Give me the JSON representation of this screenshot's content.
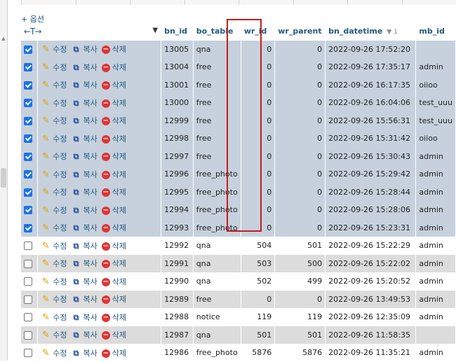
{
  "options_link": "+ 옵션",
  "columns": {
    "bn_id": "bn_id",
    "bo_table": "bo_table",
    "wr_id": "wr_id",
    "wr_parent": "wr_parent",
    "bn_datetime": "bn_datetime",
    "sort_marker": "▼ 1",
    "mb_id": "mb_id"
  },
  "actions": {
    "edit": "수정",
    "copy": "복사",
    "delete": "삭제"
  },
  "colors": {
    "selected_row": "#c6d1dd",
    "odd_row": "#dcdcdc",
    "highlight_border": "#c81c1c",
    "link": "#235a81"
  },
  "rows": [
    {
      "checked": true,
      "bn_id": "13005",
      "bo_table": "qna",
      "wr_id": "0",
      "wr_parent": "0",
      "bn_datetime": "2022-09-26 17:52:20",
      "mb_id": ""
    },
    {
      "checked": true,
      "bn_id": "13004",
      "bo_table": "free",
      "wr_id": "0",
      "wr_parent": "0",
      "bn_datetime": "2022-09-26 17:35:17",
      "mb_id": "admin"
    },
    {
      "checked": true,
      "bn_id": "13001",
      "bo_table": "free",
      "wr_id": "0",
      "wr_parent": "0",
      "bn_datetime": "2022-09-26 16:17:35",
      "mb_id": "oiioo"
    },
    {
      "checked": true,
      "bn_id": "13000",
      "bo_table": "free",
      "wr_id": "0",
      "wr_parent": "0",
      "bn_datetime": "2022-09-26 16:04:06",
      "mb_id": "test_uuu"
    },
    {
      "checked": true,
      "bn_id": "12999",
      "bo_table": "free",
      "wr_id": "0",
      "wr_parent": "0",
      "bn_datetime": "2022-09-26 15:56:31",
      "mb_id": "test_uuu"
    },
    {
      "checked": true,
      "bn_id": "12998",
      "bo_table": "free",
      "wr_id": "0",
      "wr_parent": "0",
      "bn_datetime": "2022-09-26 15:31:42",
      "mb_id": "oiioo"
    },
    {
      "checked": true,
      "bn_id": "12997",
      "bo_table": "free",
      "wr_id": "0",
      "wr_parent": "0",
      "bn_datetime": "2022-09-26 15:30:43",
      "mb_id": "admin"
    },
    {
      "checked": true,
      "bn_id": "12996",
      "bo_table": "free_photo",
      "wr_id": "0",
      "wr_parent": "0",
      "bn_datetime": "2022-09-26 15:29:42",
      "mb_id": "admin"
    },
    {
      "checked": true,
      "bn_id": "12995",
      "bo_table": "free_photo",
      "wr_id": "0",
      "wr_parent": "0",
      "bn_datetime": "2022-09-26 15:28:44",
      "mb_id": "admin"
    },
    {
      "checked": true,
      "bn_id": "12994",
      "bo_table": "free_photo",
      "wr_id": "0",
      "wr_parent": "0",
      "bn_datetime": "2022-09-26 15:28:06",
      "mb_id": "admin"
    },
    {
      "checked": true,
      "bn_id": "12993",
      "bo_table": "free_photo",
      "wr_id": "0",
      "wr_parent": "0",
      "bn_datetime": "2022-09-26 15:23:31",
      "mb_id": "admin"
    },
    {
      "checked": false,
      "bn_id": "12992",
      "bo_table": "qna",
      "wr_id": "504",
      "wr_parent": "501",
      "bn_datetime": "2022-09-26 15:22:29",
      "mb_id": "admin"
    },
    {
      "checked": false,
      "bn_id": "12991",
      "bo_table": "qna",
      "wr_id": "503",
      "wr_parent": "500",
      "bn_datetime": "2022-09-26 15:22:02",
      "mb_id": "admin"
    },
    {
      "checked": false,
      "bn_id": "12990",
      "bo_table": "qna",
      "wr_id": "502",
      "wr_parent": "499",
      "bn_datetime": "2022-09-26 15:20:52",
      "mb_id": "admin"
    },
    {
      "checked": false,
      "bn_id": "12989",
      "bo_table": "free",
      "wr_id": "0",
      "wr_parent": "0",
      "bn_datetime": "2022-09-26 13:49:53",
      "mb_id": "admin"
    },
    {
      "checked": false,
      "bn_id": "12988",
      "bo_table": "notice",
      "wr_id": "119",
      "wr_parent": "119",
      "bn_datetime": "2022-09-26 12:35:09",
      "mb_id": "admin"
    },
    {
      "checked": false,
      "bn_id": "12987",
      "bo_table": "qna",
      "wr_id": "501",
      "wr_parent": "501",
      "bn_datetime": "2022-09-26 11:58:35",
      "mb_id": ""
    },
    {
      "checked": false,
      "bn_id": "12986",
      "bo_table": "free_photo",
      "wr_id": "5876",
      "wr_parent": "5876",
      "bn_datetime": "2022-09-26 11:35:21",
      "mb_id": "admin"
    }
  ]
}
